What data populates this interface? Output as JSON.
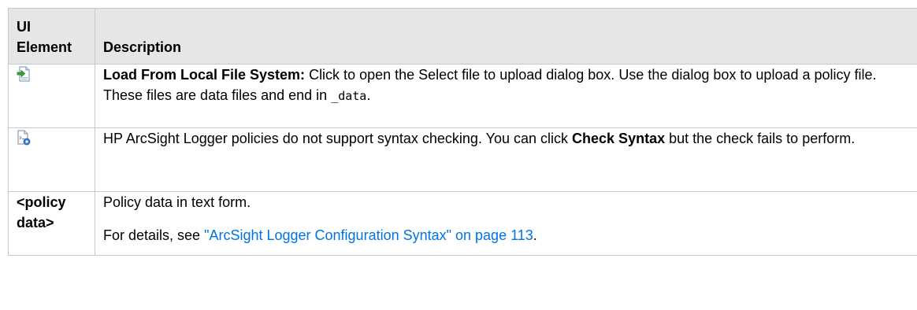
{
  "header": {
    "col1": "UI Element",
    "col1_line1": "UI",
    "col1_line2": "Element",
    "col2": "Description"
  },
  "rows": [
    {
      "icon": "load-from-file-icon",
      "title": "Load From Local File System:",
      "text_a": " Click to open the Select file to upload dialog box. Use the dialog box to upload a policy file. These files are data files and end in ",
      "code": "_data",
      "text_b": "."
    },
    {
      "icon": "check-syntax-icon",
      "text_a": "HP ArcSight Logger policies do not support syntax checking. You can click ",
      "bold": "Check Syntax",
      "text_b": " but the check fails to perform."
    },
    {
      "element_line1": "<policy",
      "element_line2": "data>",
      "para1": "Policy data in text form.",
      "para2_prefix": "For details, see ",
      "link": "\"ArcSight Logger Configuration Syntax\" on page 113",
      "para2_suffix": "."
    }
  ],
  "colors": {
    "header_bg": "#e6e6e6",
    "border": "#c8c8c8",
    "link": "#0073e7"
  }
}
